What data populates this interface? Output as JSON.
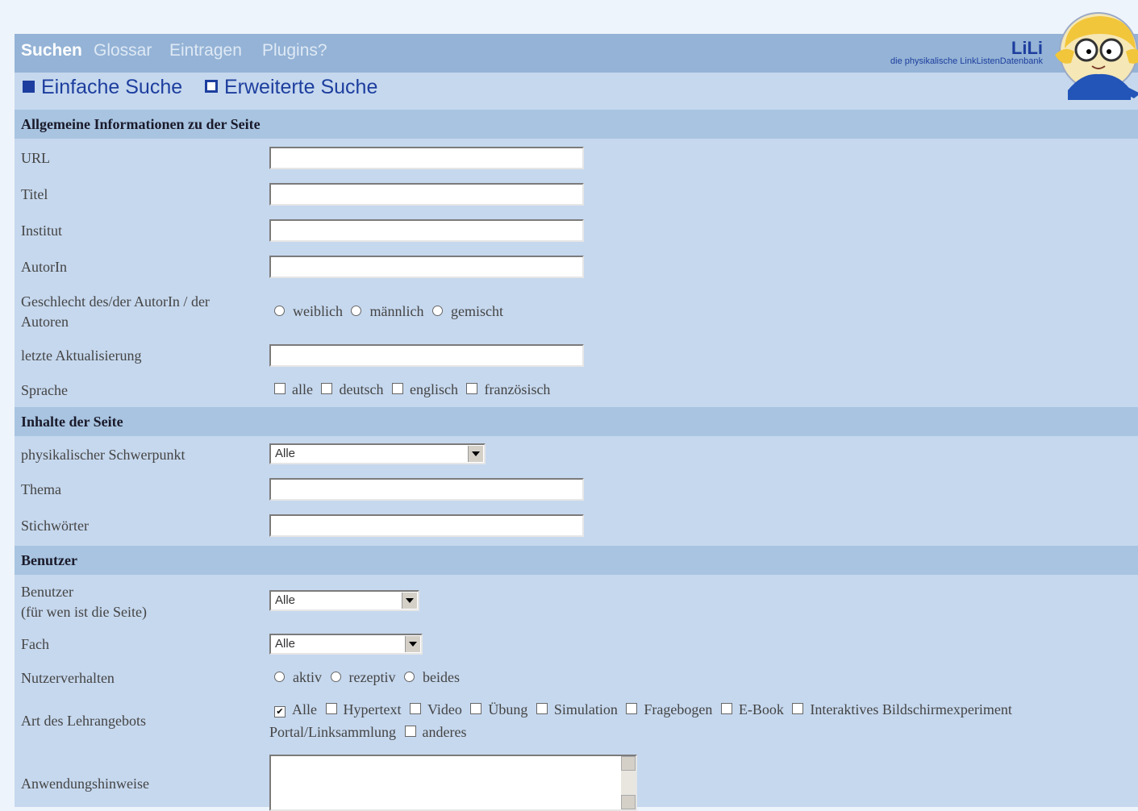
{
  "nav": {
    "items": [
      {
        "label": "Suchen",
        "active": true
      },
      {
        "label": "Glossar",
        "active": false
      },
      {
        "label": "Eintragen",
        "active": false
      },
      {
        "label": "Plugins?",
        "active": false
      }
    ],
    "brand_title": "LiLi",
    "brand_subtitle": "die physikalische LinkListenDatenbank"
  },
  "search_tabs": {
    "simple": "Einfache Suche",
    "advanced": "Erweiterte Suche"
  },
  "sections": {
    "general": "Allgemeine Informationen zu der Seite",
    "content": "Inhalte der Seite",
    "users": "Benutzer"
  },
  "fields": {
    "url": "URL",
    "titel": "Titel",
    "institut": "Institut",
    "autorin": "AutorIn",
    "geschlecht_line1": "Geschlecht des/der AutorIn / der",
    "geschlecht_line2": "Autoren",
    "geschlecht_options": [
      "weiblich",
      "männlich",
      "gemischt"
    ],
    "aktualisierung": "letzte Aktualisierung",
    "sprache": "Sprache",
    "sprache_options": [
      "alle",
      "deutsch",
      "englisch",
      "französisch"
    ],
    "schwerpunkt": "physikalischer Schwerpunkt",
    "schwerpunkt_value": "Alle",
    "thema": "Thema",
    "stichwoerter": "Stichwörter",
    "benutzer_line1": "Benutzer",
    "benutzer_line2": "(für wen ist die Seite)",
    "benutzer_value": "Alle",
    "fach": "Fach",
    "fach_value": "Alle",
    "nutzerverhalten": "Nutzerverhalten",
    "nutzerverhalten_options": [
      "aktiv",
      "rezeptiv",
      "beides"
    ],
    "lehrangebot": "Art des Lehrangebots",
    "lehrangebot_options_line1": [
      {
        "label": "Alle",
        "checked": true
      },
      {
        "label": "Hypertext",
        "checked": false
      },
      {
        "label": "Video",
        "checked": false
      },
      {
        "label": "Übung",
        "checked": false
      },
      {
        "label": "Simulation",
        "checked": false
      },
      {
        "label": "Fragebogen",
        "checked": false
      },
      {
        "label": "E-Book",
        "checked": false
      },
      {
        "label": "Interaktives Bildschirmexperiment",
        "checked": false
      }
    ],
    "lehrangebot_options_line2": [
      {
        "label": "Portal/Linksammlung",
        "checked": false
      },
      {
        "label": "anderes",
        "checked": false
      }
    ],
    "anwendung": "Anwendungshinweise"
  },
  "colors": {
    "nav_bar": "#94b3d6",
    "panel": "#c6d8ee",
    "section_header": "#a8c4e1",
    "accent": "#1d3e9e"
  },
  "icons": {
    "mascot": "cartoon-mascot-icon",
    "tab_marker": "square-bullet-icon",
    "dropdown": "chevron-down-icon"
  }
}
